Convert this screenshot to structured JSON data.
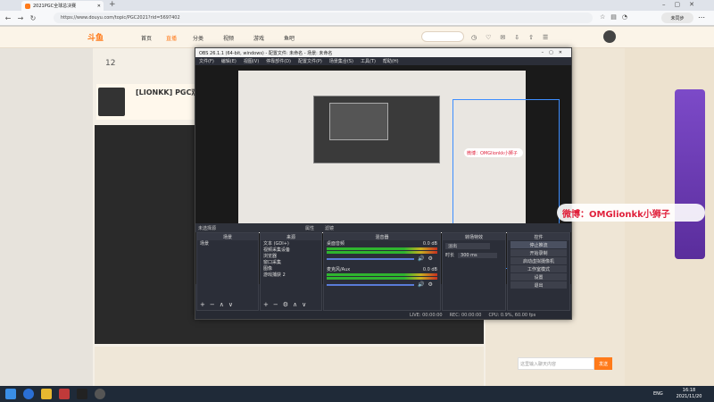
{
  "browser": {
    "tab_title": "2021PGC全球总决赛",
    "url": "https://www.douyu.com/topic/PGC2021?rid=5697402",
    "profile_label": "未同步"
  },
  "douyu": {
    "logo": "斗鱼",
    "nav": [
      "首页",
      "直播",
      "分类",
      "视频",
      "游戏",
      "鱼吧"
    ],
    "level_number": "12",
    "streamer_name": "[LIONKK] PGC观",
    "chat_placeholder": "这里输入聊天内容",
    "send_label": "发送"
  },
  "obs": {
    "title": "OBS 26.1.1 (64-bit, windows) - 配置文件: 未命名 - 场景: 未命名",
    "menu": [
      "文件(F)",
      "编辑(E)",
      "视图(V)",
      "停靠部件(D)",
      "配置文件(P)",
      "场景集合(S)",
      "工具(T)",
      "帮助(H)"
    ],
    "no_source": "未选择源",
    "tabs": [
      "属性",
      "滤镜"
    ],
    "scenes_header": "场景",
    "scenes": [
      "场景"
    ],
    "sources_header": "来源",
    "sources": [
      "文本 (GDI+)",
      "视频采集设备",
      "浏览器",
      "窗口采集",
      "图像",
      "游戏捕获 2"
    ],
    "mixer_header": "混音器",
    "mixer": [
      {
        "name": "桌面音频",
        "level": "0.0 dB"
      },
      {
        "name": "麦克风/Aux",
        "level": "0.0 dB"
      }
    ],
    "transition_header": "转场特效",
    "transition_value": "淡出",
    "duration_label": "时长",
    "duration_value": "300 ms",
    "controls_header": "控件",
    "controls": [
      "停止推流",
      "开始录制",
      "启动虚拟摄像机",
      "工作室模式",
      "设置",
      "退出"
    ],
    "status": [
      "LIVE: 00:00:00",
      "REC: 00:00:00",
      "CPU: 0.9%, 60.00 fps"
    ]
  },
  "overlay": {
    "weibo_text": "微博：OMGlionkk小狮子",
    "weibo_small": "微博：OMGlionkk小狮子"
  },
  "taskbar": {
    "lang": "ENG",
    "time": "16:18",
    "date": "2021/11/20"
  },
  "colors": {
    "brand": "#ff7a1a",
    "obs_bg": "#272a33",
    "weibo_red": "#e0223c",
    "selection": "#3d8eff"
  }
}
